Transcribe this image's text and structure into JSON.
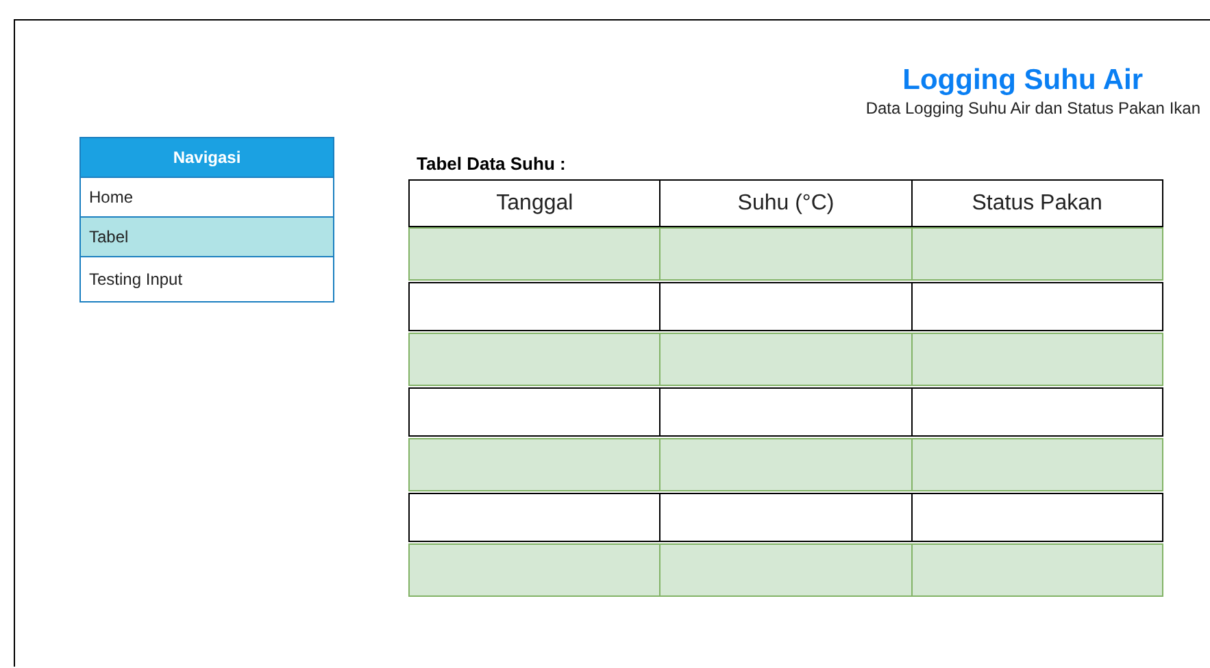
{
  "header": {
    "title": "Logging Suhu Air",
    "subtitle": "Data Logging Suhu Air dan Status Pakan Ikan"
  },
  "navigation": {
    "title": "Navigasi",
    "items": [
      {
        "label": "Home",
        "selected": false
      },
      {
        "label": "Tabel",
        "selected": true
      },
      {
        "label": "Testing Input",
        "selected": false
      }
    ]
  },
  "table": {
    "caption": "Tabel Data Suhu :",
    "columns": [
      "Tanggal",
      "Suhu (°C)",
      "Status Pakan"
    ],
    "rows": [
      {
        "color": "#d5e8d4"
      },
      {
        "color": "#ffffff"
      },
      {
        "color": "#d5e8d4"
      },
      {
        "color": "#ffffff"
      },
      {
        "color": "#d5e8d4"
      },
      {
        "color": "#ffffff"
      },
      {
        "color": "#d5e8d4"
      }
    ]
  }
}
